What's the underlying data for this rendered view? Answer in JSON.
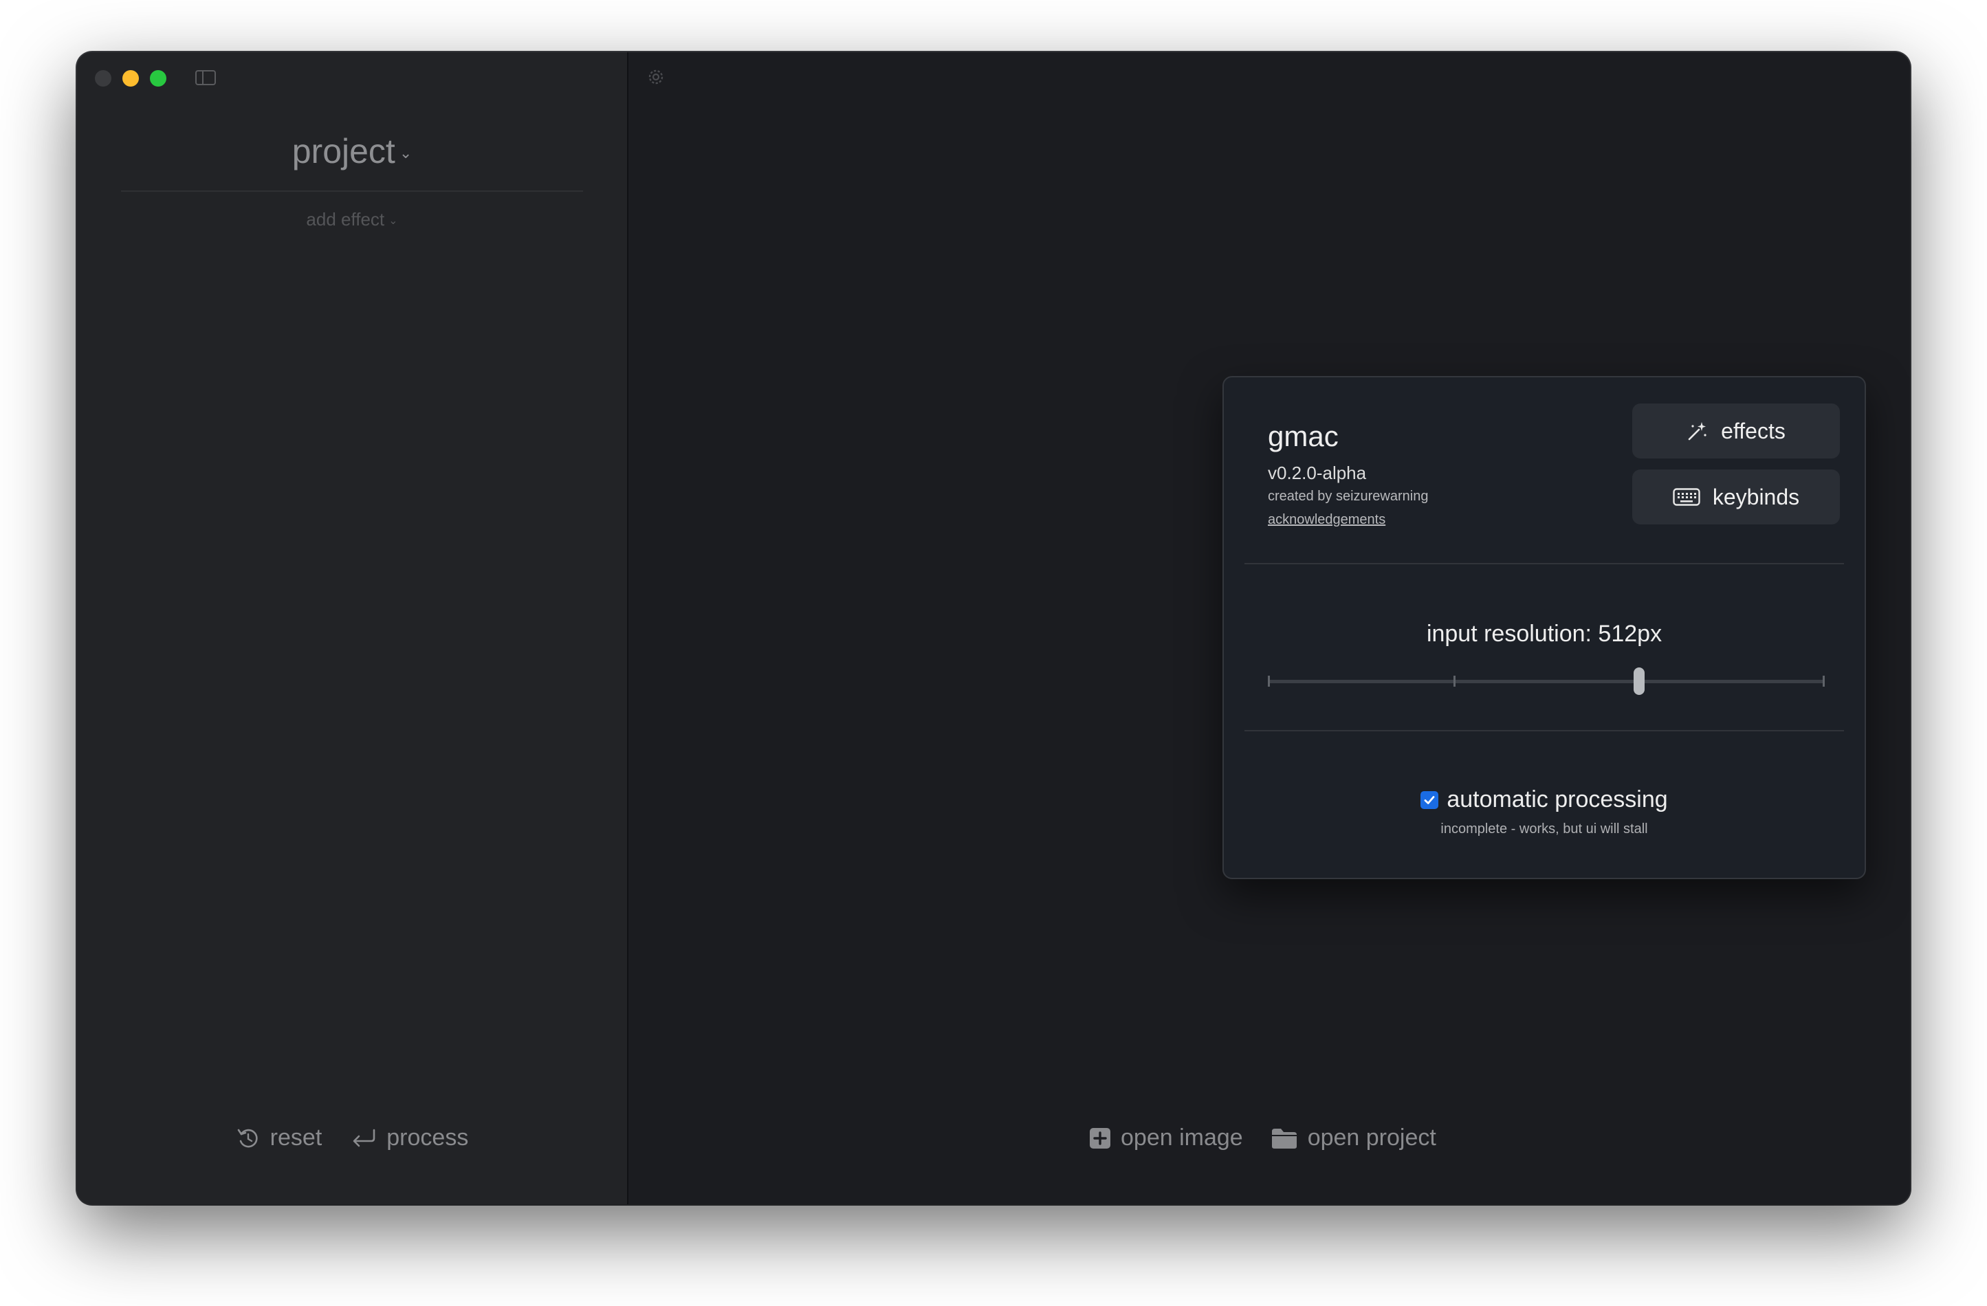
{
  "colors": {
    "sidebar_bg": "#222326",
    "main_bg": "#1b1c20",
    "dialog_bg": "#1c2027",
    "button_bg": "#2a2e35",
    "checkbox_accent": "#1a6ce4"
  },
  "sidebar": {
    "project_label": "project",
    "project_chevron": "⌄",
    "add_effect_label": "add effect",
    "add_effect_chevron": "⌄",
    "actions": {
      "reset_label": "reset",
      "reset_icon": "counterclockwise-arrow-icon",
      "process_label": "process",
      "process_icon": "return-arrow-icon"
    }
  },
  "main": {
    "settings_icon": "gear-icon",
    "actions": {
      "open_image_label": "open image",
      "open_image_icon": "plus-square-icon",
      "open_project_label": "open project",
      "open_project_icon": "folder-icon"
    }
  },
  "dialog": {
    "app_name": "gmac",
    "version": "v0.2.0-alpha",
    "credit": "created by seizurewarning",
    "acknowledgements_link": "acknowledgements",
    "effects_button": "effects",
    "keybinds_button": "keybinds",
    "resolution_label": "input resolution: 512px",
    "resolution_slider": {
      "tick_count": 4,
      "selected_index": 2
    },
    "auto_processing": {
      "label": "automatic processing",
      "checked": true,
      "note": "incomplete - works, but ui will stall"
    }
  }
}
